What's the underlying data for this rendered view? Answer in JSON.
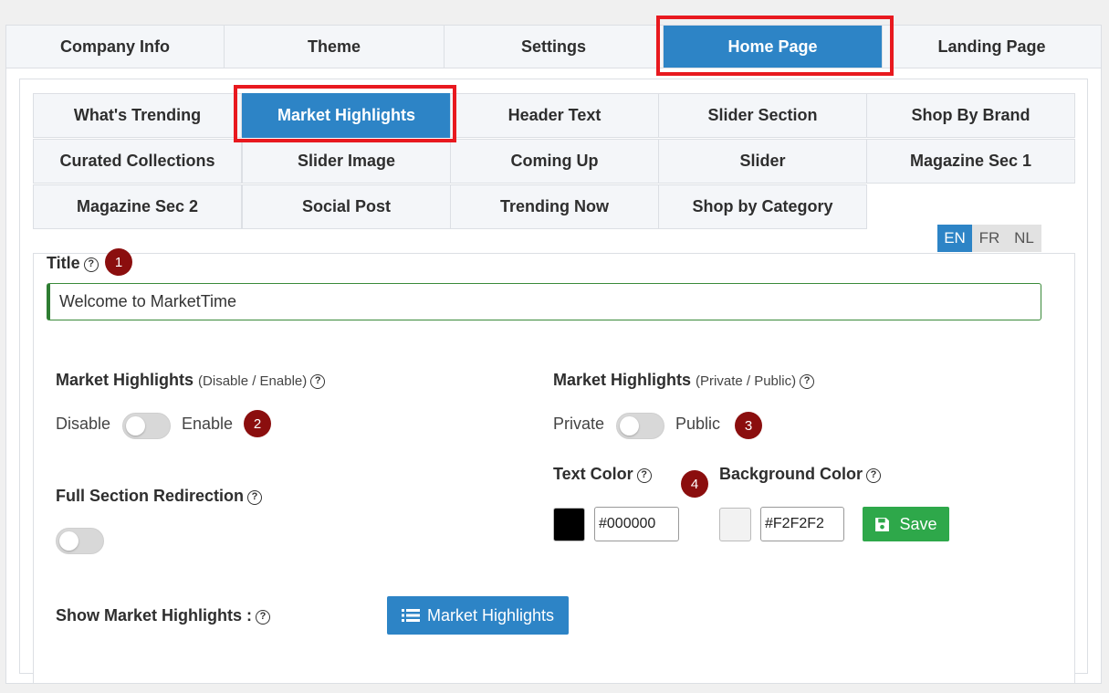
{
  "top_tabs": [
    "Company Info",
    "Theme",
    "Settings",
    "Home Page",
    "Landing Page"
  ],
  "active_top_tab": "Home Page",
  "sub_tabs": [
    "What's Trending",
    "Market Highlights",
    "Header Text",
    "Slider Section",
    "Shop By Brand",
    "Curated Collections",
    "Slider Image",
    "Coming Up",
    "Slider",
    "Magazine Sec 1",
    "Magazine Sec 2",
    "Social Post",
    "Trending Now",
    "Shop by Category"
  ],
  "active_sub_tab": "Market Highlights",
  "title_section": {
    "label": "Title",
    "value": "Welcome to MarketTime",
    "languages": [
      "EN",
      "FR",
      "NL"
    ],
    "active_language": "EN"
  },
  "enable_section": {
    "label": "Market Highlights",
    "sub": "(Disable / Enable)",
    "left": "Disable",
    "right": "Enable"
  },
  "visibility_section": {
    "label": "Market Highlights",
    "sub": "(Private / Public)",
    "left": "Private",
    "right": "Public"
  },
  "redirection_section": {
    "label": "Full Section Redirection"
  },
  "text_color": {
    "label": "Text Color",
    "value": "#000000"
  },
  "background_color": {
    "label": "Background Color",
    "value": "#F2F2F2"
  },
  "save_label": "Save",
  "show_section": {
    "label": "Show Market Highlights :",
    "button_label": "Market Highlights"
  },
  "badges": [
    "1",
    "2",
    "3",
    "4"
  ],
  "colors": {
    "accent": "#2d84c6",
    "save": "#2ea84a",
    "badge": "#8b0e0e",
    "highlight": "#e8191f"
  }
}
